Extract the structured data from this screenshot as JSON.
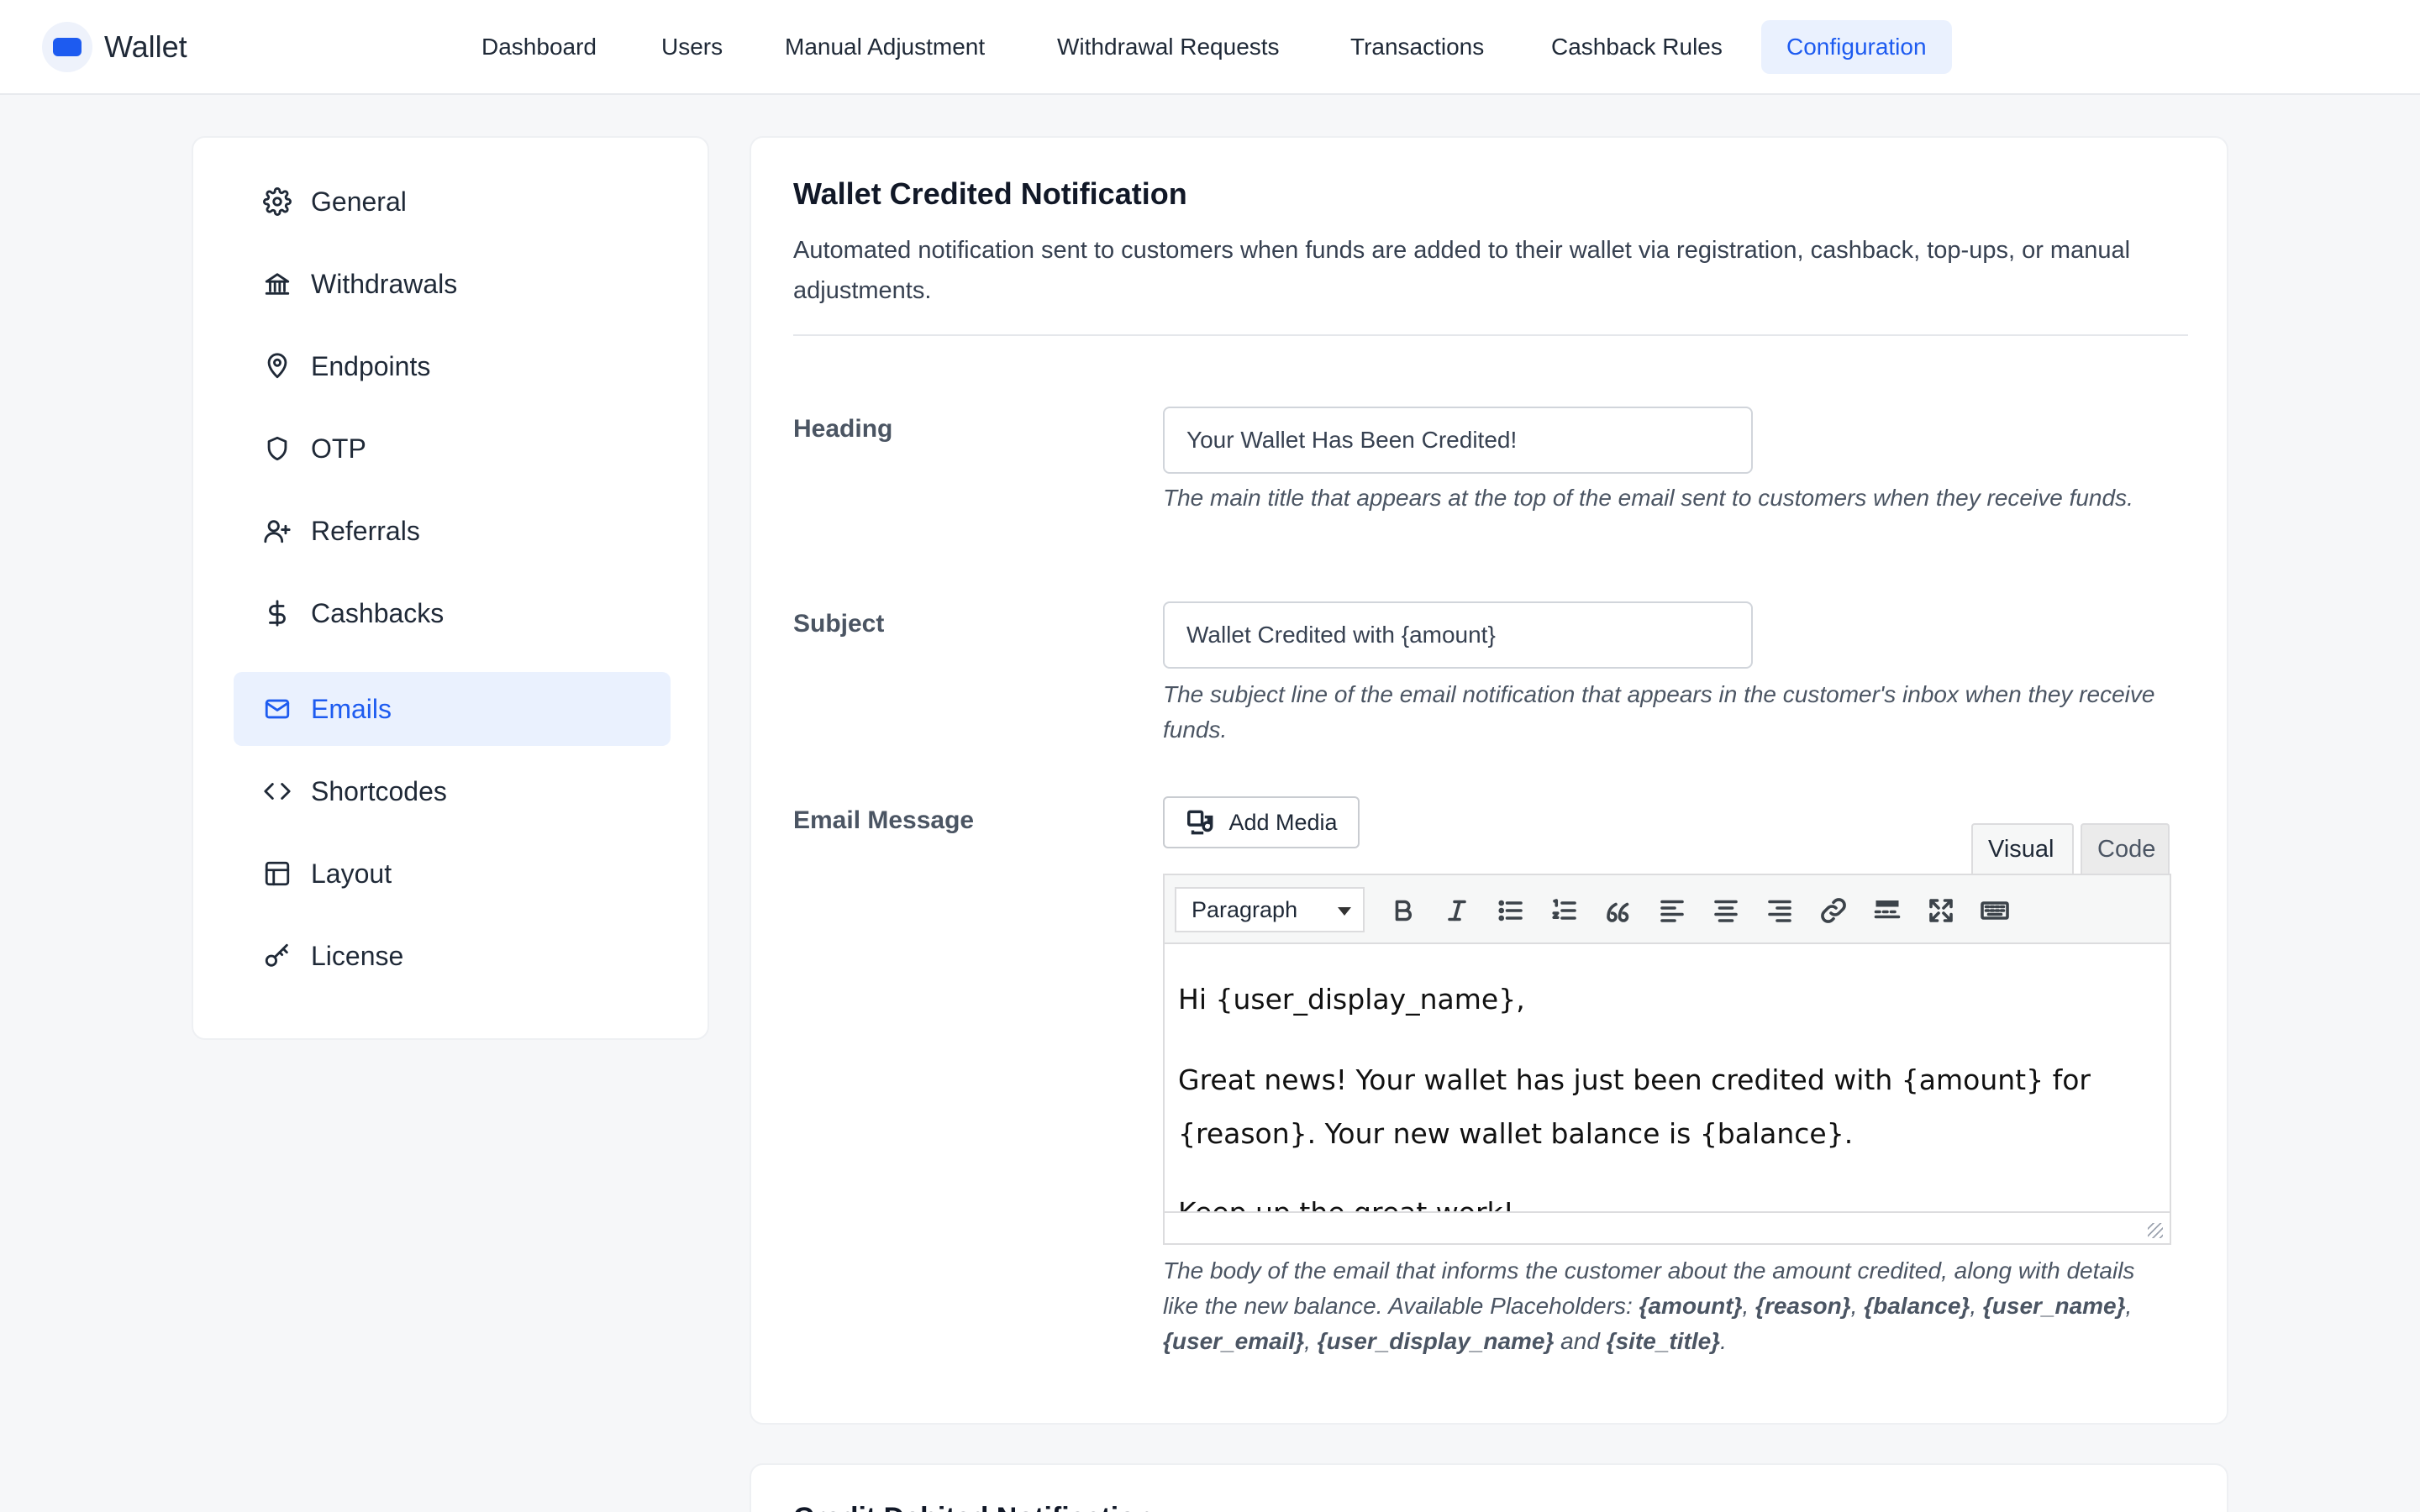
{
  "app": {
    "name": "Wallet",
    "accent": "#1d5bf0"
  },
  "nav": {
    "items": [
      {
        "label": "Dashboard"
      },
      {
        "label": "Users"
      },
      {
        "label": "Manual Adjustment"
      },
      {
        "label": "Withdrawal Requests"
      },
      {
        "label": "Transactions"
      },
      {
        "label": "Cashback Rules"
      },
      {
        "label": "Configuration",
        "active": true
      }
    ]
  },
  "sidebar": {
    "items": [
      {
        "label": "General",
        "icon": "gear-icon"
      },
      {
        "label": "Withdrawals",
        "icon": "bank-icon"
      },
      {
        "label": "Endpoints",
        "icon": "map-pin-icon"
      },
      {
        "label": "OTP",
        "icon": "shield-icon"
      },
      {
        "label": "Referrals",
        "icon": "user-plus-icon"
      },
      {
        "label": "Cashbacks",
        "icon": "dollar-icon"
      },
      {
        "label": "Emails",
        "icon": "mail-icon",
        "active": true
      },
      {
        "label": "Shortcodes",
        "icon": "code-icon"
      },
      {
        "label": "Layout",
        "icon": "layout-icon"
      },
      {
        "label": "License",
        "icon": "key-icon"
      }
    ]
  },
  "section": {
    "title": "Wallet Credited Notification",
    "description": "Automated notification sent to customers when funds are added to their wallet via registration, cashback, top-ups, or manual adjustments."
  },
  "fields": {
    "heading": {
      "label": "Heading",
      "value": "Your Wallet Has Been Credited!",
      "help": "The main title that appears at the top of the email sent to customers when they receive funds."
    },
    "subject": {
      "label": "Subject",
      "value": "Wallet Credited with {amount}",
      "help": "The subject line of the email notification that appears in the customer's inbox when they receive funds."
    },
    "message": {
      "label": "Email Message",
      "add_media": "Add Media",
      "tab_visual": "Visual",
      "tab_code": "Code",
      "format": "Paragraph",
      "paragraphs": [
        "Hi {user_display_name},",
        "Great news! Your wallet has just been credited with {amount} for {reason}. Your new wallet balance is {balance}.",
        "Keep up the great work!"
      ],
      "help_prefix": "The body of the email that informs the customer about the amount credited, along with details like the new balance. Available Placeholders: ",
      "placeholders": [
        "{amount}",
        "{reason}",
        "{balance}",
        "{user_name}",
        "{user_email}",
        "{user_display_name}"
      ],
      "last_placeholder": "{site_title}",
      "sep": ", ",
      "and": " and ",
      "end": "."
    }
  },
  "next_section": {
    "title": "Credit Debited Notification"
  }
}
